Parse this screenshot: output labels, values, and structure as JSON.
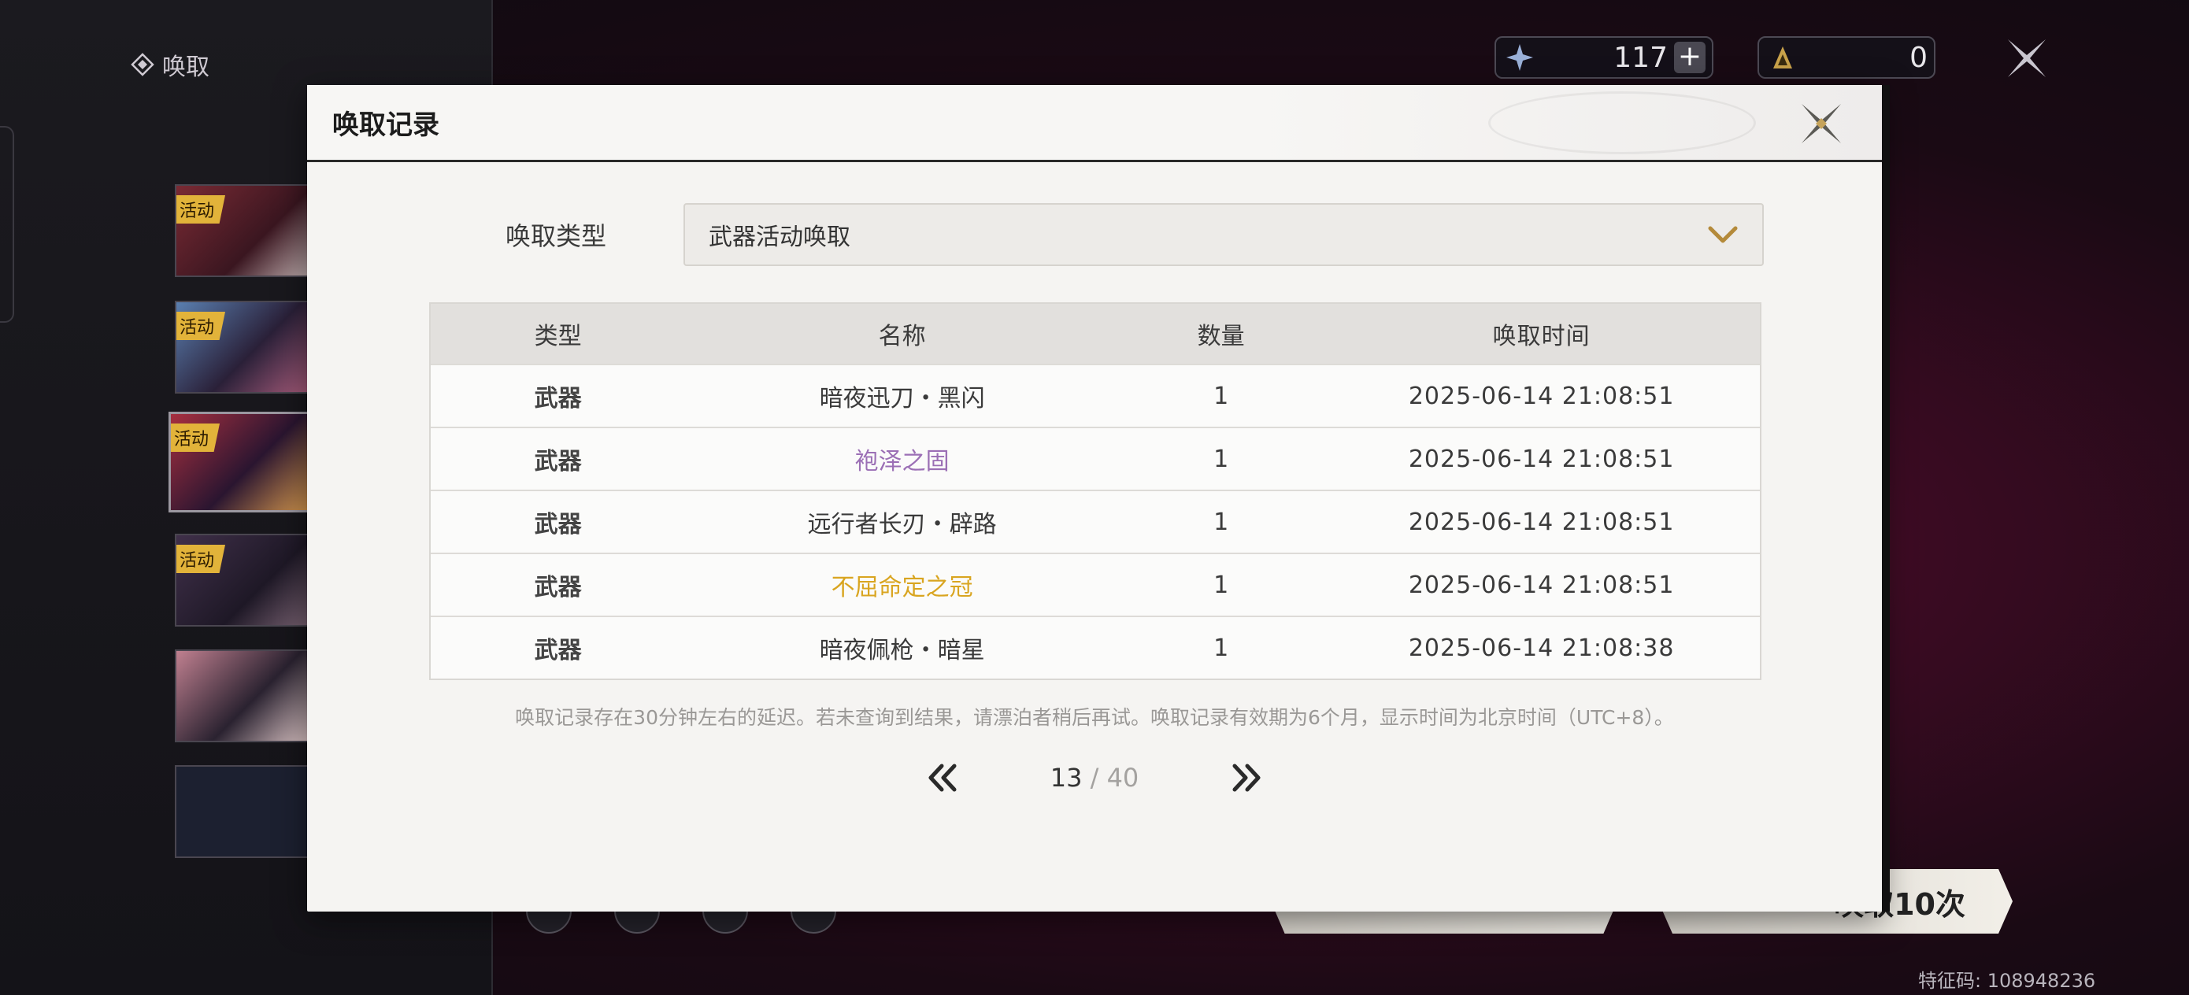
{
  "background": {
    "section_title": "唤取",
    "banners": [
      {
        "tag": "活动"
      },
      {
        "tag": "活动"
      },
      {
        "tag": "活动"
      },
      {
        "tag": "活动"
      },
      {
        "tag": ""
      },
      {
        "tag": ""
      }
    ],
    "currency_1": {
      "icon": "star-gem-icon",
      "value": "117",
      "plus_label": "+"
    },
    "currency_2": {
      "icon": "tide-token-icon",
      "value": "0"
    },
    "draw_button_2_label": "唤取10次",
    "feature_code": "特征码: 108948236"
  },
  "dialog": {
    "title": "唤取记录",
    "filter": {
      "label": "唤取类型",
      "selected": "武器活动唤取"
    },
    "table": {
      "headers": [
        "类型",
        "名称",
        "数量",
        "唤取时间"
      ],
      "rows": [
        {
          "type": "武器",
          "name": "暗夜迅刀・黑闪",
          "count": "1",
          "time": "2025-06-14 21:08:51",
          "color": "#3a3a3a"
        },
        {
          "type": "武器",
          "name": "袍泽之固",
          "count": "1",
          "time": "2025-06-14 21:08:51",
          "color": "#9b6fb5"
        },
        {
          "type": "武器",
          "name": "远行者长刃・辟路",
          "count": "1",
          "time": "2025-06-14 21:08:51",
          "color": "#3a3a3a"
        },
        {
          "type": "武器",
          "name": "不屈命定之冠",
          "count": "1",
          "time": "2025-06-14 21:08:51",
          "color": "#d9a520"
        },
        {
          "type": "武器",
          "name": "暗夜佩枪・暗星",
          "count": "1",
          "time": "2025-06-14 21:08:38",
          "color": "#3a3a3a"
        }
      ]
    },
    "note": "唤取记录存在30分钟左右的延迟。若未查询到结果，请漂泊者稍后再试。唤取记录有效期为6个月，显示时间为北京时间（UTC+8）。",
    "pager": {
      "current": "13",
      "separator": " / ",
      "total": "40"
    }
  }
}
